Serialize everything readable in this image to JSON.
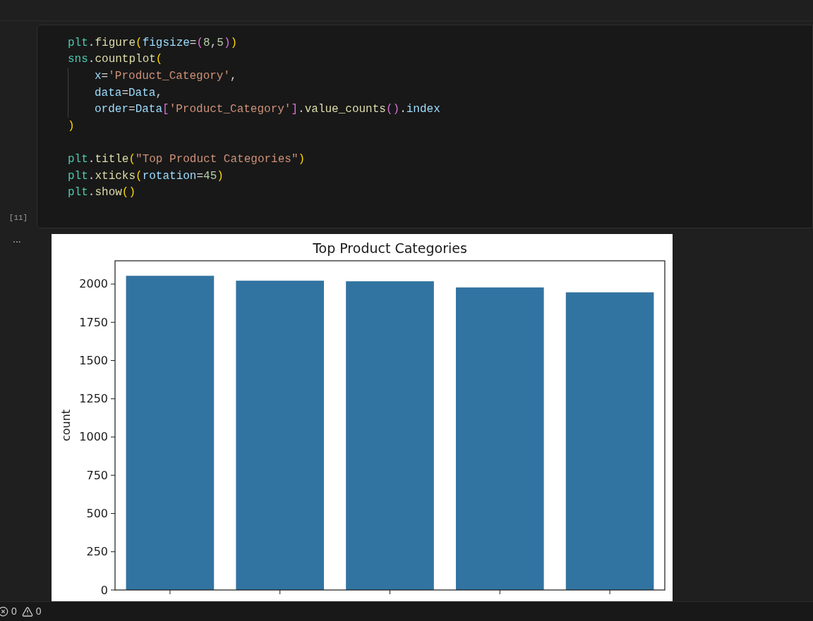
{
  "cell": {
    "execution_count": "[11]",
    "lines": [
      {
        "kind": "plain",
        "tokens": [
          {
            "text": "plt",
            "kind": "module"
          },
          {
            "text": ".",
            "kind": "punct"
          },
          {
            "text": "figure",
            "kind": "func"
          },
          {
            "text": "(",
            "kind": "bracket1"
          },
          {
            "text": "figsize",
            "kind": "param"
          },
          {
            "text": "=",
            "kind": "punct"
          },
          {
            "text": "(",
            "kind": "bracket2"
          },
          {
            "text": "8",
            "kind": "number"
          },
          {
            "text": ",",
            "kind": "punct"
          },
          {
            "text": "5",
            "kind": "number"
          },
          {
            "text": ")",
            "kind": "bracket2"
          },
          {
            "text": ")",
            "kind": "bracket1"
          }
        ]
      },
      {
        "kind": "plain",
        "tokens": [
          {
            "text": "sns",
            "kind": "module"
          },
          {
            "text": ".",
            "kind": "punct"
          },
          {
            "text": "countplot",
            "kind": "func"
          },
          {
            "text": "(",
            "kind": "bracket1"
          }
        ]
      },
      {
        "kind": "indented",
        "tokens": [
          {
            "text": "x",
            "kind": "param"
          },
          {
            "text": "=",
            "kind": "punct"
          },
          {
            "text": "'Product_Category'",
            "kind": "string"
          },
          {
            "text": ",",
            "kind": "punct"
          }
        ]
      },
      {
        "kind": "indented",
        "tokens": [
          {
            "text": "data",
            "kind": "param"
          },
          {
            "text": "=",
            "kind": "punct"
          },
          {
            "text": "Data",
            "kind": "param"
          },
          {
            "text": ",",
            "kind": "punct"
          }
        ]
      },
      {
        "kind": "indented",
        "tokens": [
          {
            "text": "order",
            "kind": "param"
          },
          {
            "text": "=",
            "kind": "punct"
          },
          {
            "text": "Data",
            "kind": "param"
          },
          {
            "text": "[",
            "kind": "bracket2"
          },
          {
            "text": "'Product_Category'",
            "kind": "string"
          },
          {
            "text": "]",
            "kind": "bracket2"
          },
          {
            "text": ".",
            "kind": "punct"
          },
          {
            "text": "value_counts",
            "kind": "func"
          },
          {
            "text": "(",
            "kind": "bracket2"
          },
          {
            "text": ")",
            "kind": "bracket2"
          },
          {
            "text": ".",
            "kind": "punct"
          },
          {
            "text": "index",
            "kind": "param"
          }
        ]
      },
      {
        "kind": "plain",
        "tokens": [
          {
            "text": ")",
            "kind": "bracket1"
          }
        ]
      },
      {
        "kind": "blank"
      },
      {
        "kind": "plain",
        "tokens": [
          {
            "text": "plt",
            "kind": "module"
          },
          {
            "text": ".",
            "kind": "punct"
          },
          {
            "text": "title",
            "kind": "func"
          },
          {
            "text": "(",
            "kind": "bracket1"
          },
          {
            "text": "\"Top Product Categories\"",
            "kind": "string"
          },
          {
            "text": ")",
            "kind": "bracket1"
          }
        ]
      },
      {
        "kind": "plain",
        "tokens": [
          {
            "text": "plt",
            "kind": "module"
          },
          {
            "text": ".",
            "kind": "punct"
          },
          {
            "text": "xticks",
            "kind": "func"
          },
          {
            "text": "(",
            "kind": "bracket1"
          },
          {
            "text": "rotation",
            "kind": "param"
          },
          {
            "text": "=",
            "kind": "punct"
          },
          {
            "text": "45",
            "kind": "number"
          },
          {
            "text": ")",
            "kind": "bracket1"
          }
        ]
      },
      {
        "kind": "plain",
        "tokens": [
          {
            "text": "plt",
            "kind": "module"
          },
          {
            "text": ".",
            "kind": "punct"
          },
          {
            "text": "show",
            "kind": "func"
          },
          {
            "text": "(",
            "kind": "bracket1"
          },
          {
            "text": ")",
            "kind": "bracket1"
          }
        ]
      }
    ]
  },
  "output": {
    "more_label": "...",
    "chart_data": {
      "type": "bar",
      "title": "Top Product Categories",
      "ylabel": "count",
      "categories": [
        null,
        null,
        null,
        null,
        null
      ],
      "series": [
        {
          "color": "#3274a1",
          "values": [
            2054,
            2022,
            2018,
            1978,
            1946
          ]
        }
      ],
      "ylim": [
        0,
        2152
      ],
      "yticks": [
        0,
        250,
        500,
        750,
        1000,
        1250,
        1500,
        1750,
        2000
      ]
    }
  },
  "status_bar": {
    "errors": "0",
    "warnings": "0"
  }
}
